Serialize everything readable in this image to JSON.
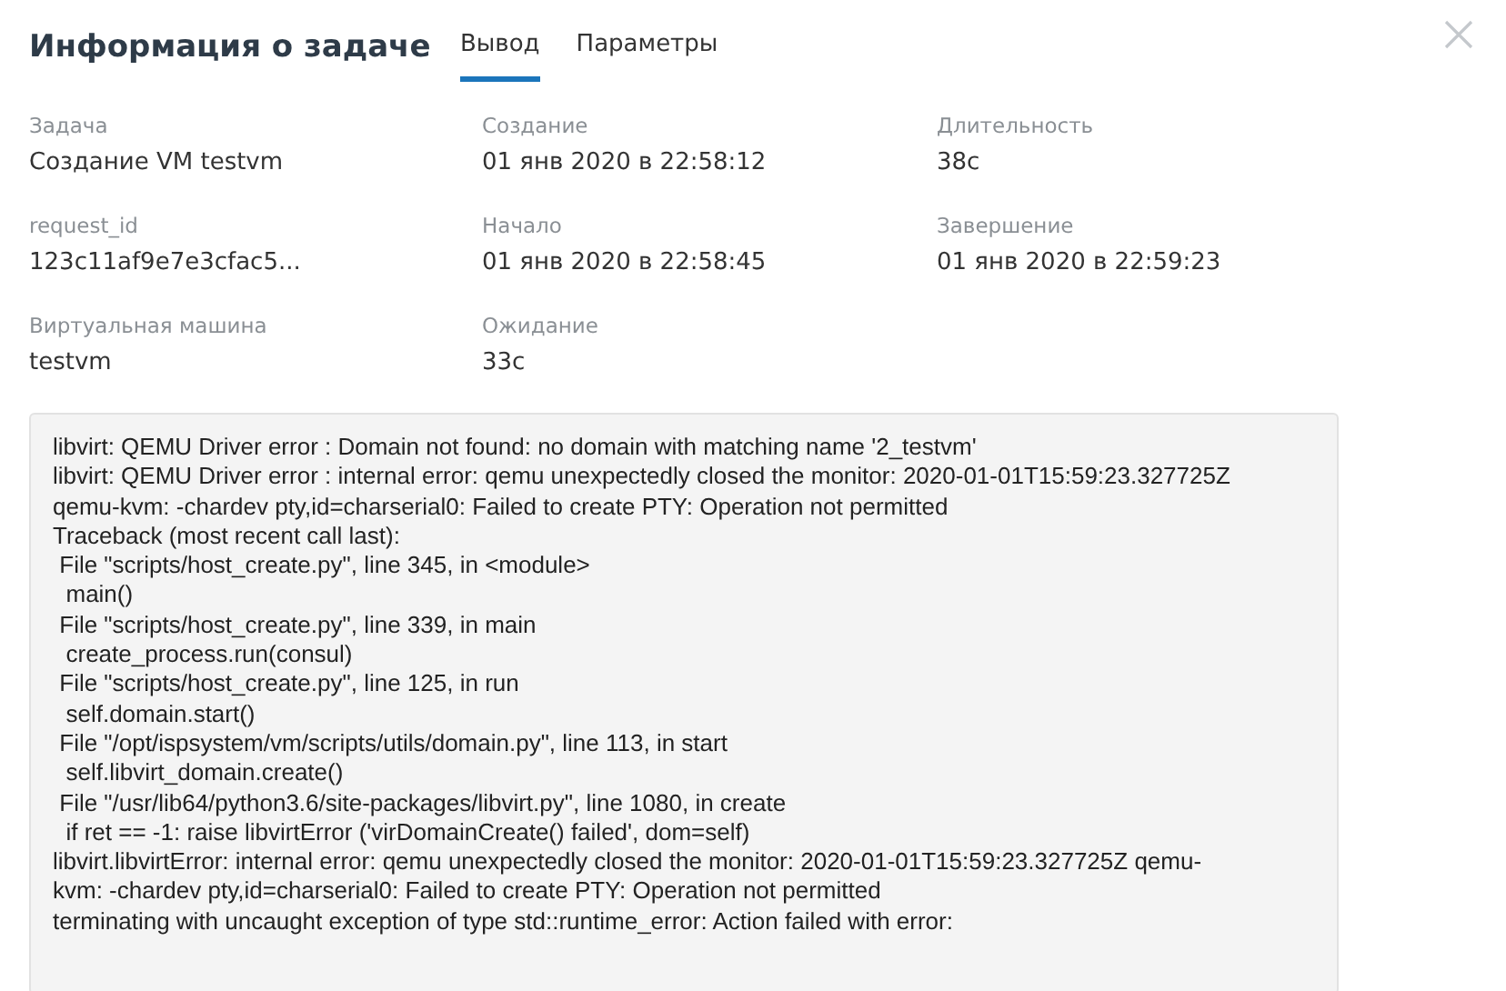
{
  "dialog": {
    "title": "Информация о задаче"
  },
  "tabs": [
    {
      "label": "Вывод",
      "selected": true
    },
    {
      "label": "Параметры",
      "selected": false
    }
  ],
  "fields": [
    {
      "label": "Задача",
      "value": "Создание VM testvm"
    },
    {
      "label": "Создание",
      "value": "01 янв 2020 в 22:58:12"
    },
    {
      "label": "Длительность",
      "value": "38с"
    },
    {
      "label": "request_id",
      "value": "123c11af9e7e3cfac5..."
    },
    {
      "label": "Начало",
      "value": "01 янв 2020 в 22:58:45"
    },
    {
      "label": "Завершение",
      "value": "01 янв 2020 в 22:59:23"
    },
    {
      "label": "Виртуальная машина",
      "value": "testvm"
    },
    {
      "label": "Ожидание",
      "value": "33с"
    }
  ],
  "output_log": [
    "libvirt: QEMU Driver error : Domain not found: no domain with matching name '2_testvm'",
    "libvirt: QEMU Driver error : internal error: qemu unexpectedly closed the monitor: 2020-01-01T15:59:23.327725Z",
    "qemu-kvm: -chardev pty,id=charserial0: Failed to create PTY: Operation not permitted",
    "Traceback (most recent call last):",
    " File \"scripts/host_create.py\", line 345, in <module>",
    "  main()",
    " File \"scripts/host_create.py\", line 339, in main",
    "  create_process.run(consul)",
    " File \"scripts/host_create.py\", line 125, in run",
    "  self.domain.start()",
    " File \"/opt/ispsystem/vm/scripts/utils/domain.py\", line 113, in start",
    "  self.libvirt_domain.create()",
    " File \"/usr/lib64/python3.6/site-packages/libvirt.py\", line 1080, in create",
    "  if ret == -1: raise libvirtError ('virDomainCreate() failed', dom=self)",
    "libvirt.libvirtError: internal error: qemu unexpectedly closed the monitor: 2020-01-01T15:59:23.327725Z qemu-",
    "kvm: -chardev pty,id=charserial0: Failed to create PTY: Operation not permitted",
    "terminating with uncaught exception of type std::runtime_error: Action failed with error:"
  ]
}
